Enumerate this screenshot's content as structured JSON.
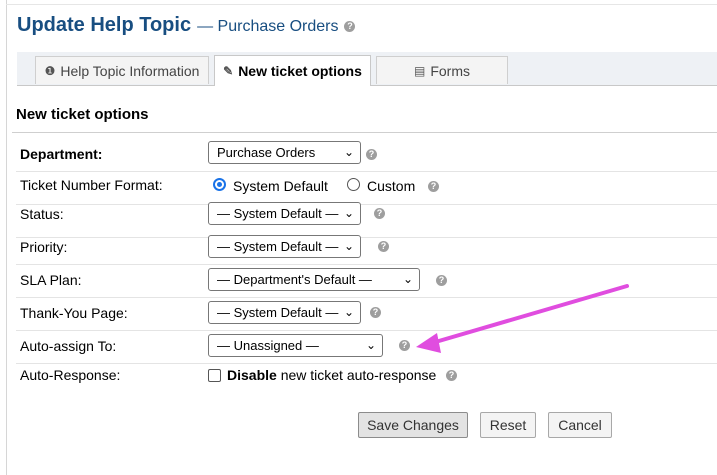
{
  "header": {
    "title": "Update Help Topic",
    "subtitle": "— Purchase Orders",
    "help": "?"
  },
  "tabs": [
    {
      "label": "Help Topic Information",
      "icon": "info-icon",
      "glyph": "❶",
      "active": false
    },
    {
      "label": "New ticket options",
      "icon": "tag-icon",
      "glyph": "✎",
      "active": true
    },
    {
      "label": "Forms",
      "icon": "forms-icon",
      "glyph": "▤",
      "active": false
    }
  ],
  "section": {
    "title": "New ticket options"
  },
  "fields": {
    "department": {
      "label": "Department:",
      "value": "Purchase Orders"
    },
    "ticket_number_format": {
      "label": "Ticket Number Format:",
      "option1": "System Default",
      "option2": "Custom",
      "selected": "System Default"
    },
    "status": {
      "label": "Status:",
      "value": "— System Default —"
    },
    "priority": {
      "label": "Priority:",
      "value": "— System Default —"
    },
    "sla_plan": {
      "label": "SLA Plan:",
      "value": "— Department's Default —"
    },
    "thank_you_page": {
      "label": "Thank-You Page:",
      "value": "— System Default —"
    },
    "auto_assign": {
      "label": "Auto-assign To:",
      "value": "— Unassigned —"
    },
    "auto_response": {
      "label": "Auto-Response:",
      "bold": "Disable",
      "text": " new ticket auto-response",
      "checked": false
    }
  },
  "buttons": {
    "save": "Save Changes",
    "reset": "Reset",
    "cancel": "Cancel"
  },
  "colors": {
    "title": "#184e81",
    "annotation_arrow": "#e04ddf",
    "radio_accent": "#1a73e8"
  }
}
